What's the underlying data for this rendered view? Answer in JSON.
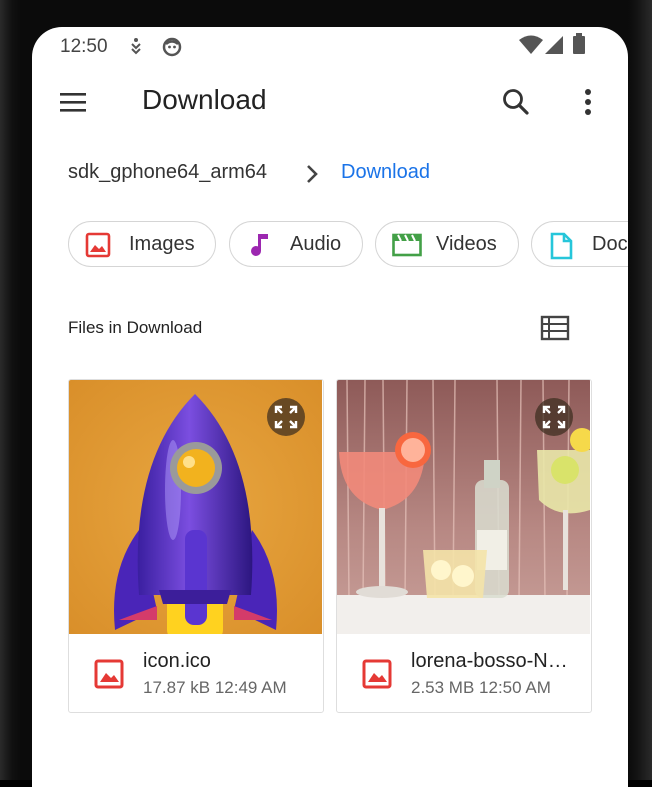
{
  "status_bar": {
    "time": "12:50",
    "left_icons": [
      "motion-icon",
      "face-icon"
    ],
    "right_icons": [
      "wifi-icon",
      "signal-icon",
      "battery-icon"
    ]
  },
  "app_bar": {
    "title": "Download",
    "icons": [
      "hamburger-menu-icon",
      "search-icon",
      "more-vert-icon"
    ]
  },
  "breadcrumb": {
    "root": "sdk_gphone64_arm64",
    "current": "Download"
  },
  "chips": [
    {
      "label": "Images",
      "icon": "image-icon",
      "color": "#e53935"
    },
    {
      "label": "Audio",
      "icon": "music-note-icon",
      "color": "#9c27b0"
    },
    {
      "label": "Videos",
      "icon": "movie-icon",
      "color": "#43a047"
    },
    {
      "label": "Doc",
      "icon": "document-icon",
      "color": "#26c6da"
    }
  ],
  "section": {
    "title": "Files in Download",
    "view_toggle_icon": "list-view-icon"
  },
  "files": [
    {
      "name": "icon.ico",
      "size": "17.87 kB",
      "time": "12:49 AM",
      "meta": "17.87 kB 12:49 AM",
      "type_icon": "image-icon"
    },
    {
      "name": "lorena-bosso-N…",
      "size": "2.53 MB",
      "time": "12:50 AM",
      "meta": "2.53 MB 12:50 AM",
      "type_icon": "image-icon"
    }
  ],
  "colors": {
    "accent": "#1a73e8",
    "image_icon": "#e53935",
    "text_primary": "#222222",
    "text_secondary": "#666666"
  }
}
